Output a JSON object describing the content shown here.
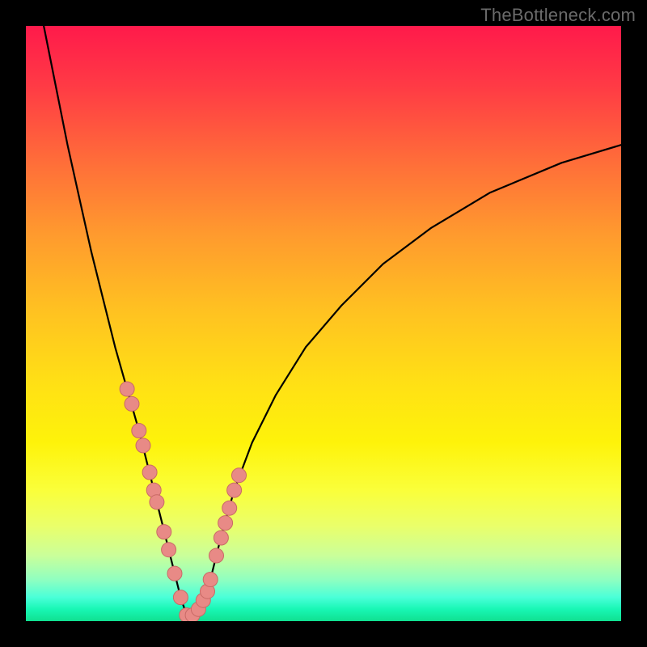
{
  "watermark": "TheBottleneck.com",
  "colors": {
    "frame": "#000000",
    "curve": "#000000",
    "marker_fill": "#e88a86",
    "marker_stroke": "#c96a66"
  },
  "chart_data": {
    "type": "line",
    "title": "",
    "xlabel": "",
    "ylabel": "",
    "xlim": [
      0,
      100
    ],
    "ylim": [
      0,
      100
    ],
    "grid": false,
    "legend": false,
    "note": "V-shaped bottleneck curve; minimum near x≈27; y represents approximate percentage bottleneck. Values estimated from pixel positions.",
    "series": [
      {
        "name": "curve",
        "x": [
          3,
          5,
          7,
          9,
          11,
          13,
          15,
          17,
          19,
          20,
          21,
          22,
          23,
          24,
          25,
          26,
          27,
          28,
          29,
          30,
          31,
          32,
          33,
          35,
          38,
          42,
          47,
          53,
          60,
          68,
          78,
          90,
          100
        ],
        "y": [
          100,
          90,
          80,
          71,
          62,
          54,
          46,
          39,
          32,
          28,
          24,
          20,
          16,
          12,
          8,
          4,
          1,
          1,
          2,
          4,
          7,
          11,
          15,
          22,
          30,
          38,
          46,
          53,
          60,
          66,
          72,
          77,
          80
        ]
      }
    ],
    "markers": {
      "name": "highlighted-points",
      "x": [
        17.0,
        17.8,
        19.0,
        19.7,
        20.8,
        21.5,
        22.0,
        23.2,
        24.0,
        25.0,
        26.0,
        27.0,
        28.0,
        29.0,
        29.8,
        30.5,
        31.0,
        32.0,
        32.8,
        33.5,
        34.2,
        35.0,
        35.8
      ],
      "y": [
        39.0,
        36.5,
        32.0,
        29.5,
        25.0,
        22.0,
        20.0,
        15.0,
        12.0,
        8.0,
        4.0,
        1.0,
        1.0,
        2.0,
        3.5,
        5.0,
        7.0,
        11.0,
        14.0,
        16.5,
        19.0,
        22.0,
        24.5
      ]
    }
  }
}
